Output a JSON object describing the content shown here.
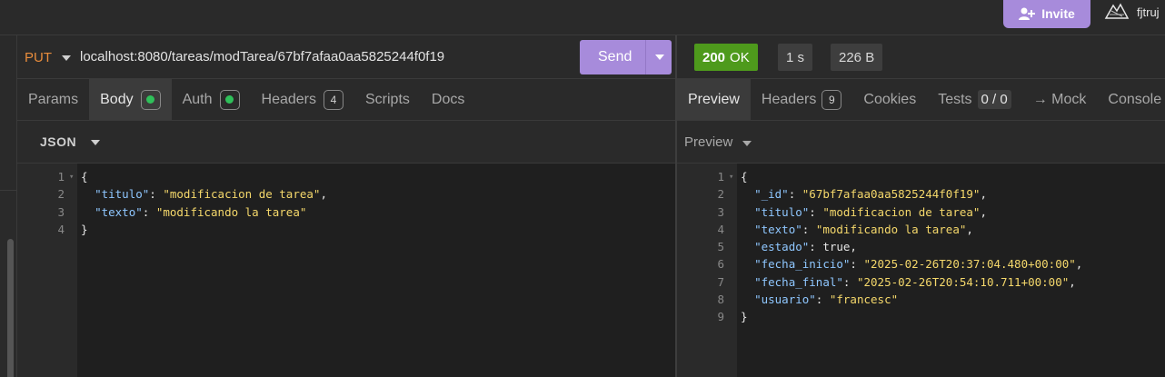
{
  "topbar": {
    "invite_label": "Invite",
    "username": "fjtruj"
  },
  "request": {
    "method": "PUT",
    "url": "localhost:8080/tareas/modTarea/67bf7afaa0aa5825244f0f19",
    "send_label": "Send",
    "tabs": [
      {
        "label": "Params"
      },
      {
        "label": "Body"
      },
      {
        "label": "Auth"
      },
      {
        "label": "Headers",
        "count": "4"
      },
      {
        "label": "Scripts"
      },
      {
        "label": "Docs"
      }
    ],
    "body_type": "JSON",
    "line_numbers": [
      "1",
      "2",
      "3",
      "4"
    ],
    "body_lines": [
      {
        "p": "{"
      },
      {
        "ind": "  ",
        "k": "\"titulo\"",
        "p": ": ",
        "v": "\"modificacion de tarea\"",
        "e": ","
      },
      {
        "ind": "  ",
        "k": "\"texto\"",
        "p": ": ",
        "v": "\"modificando la tarea\"",
        "e": ""
      },
      {
        "p": "}"
      }
    ]
  },
  "response": {
    "status_code": "200",
    "status_text": "OK",
    "time": "1 s",
    "size": "226 B",
    "tabs": [
      {
        "label": "Preview"
      },
      {
        "label": "Headers",
        "count": "9"
      },
      {
        "label": "Cookies"
      },
      {
        "label": "Tests",
        "value": "0 / 0"
      },
      {
        "label": "→ Mock"
      },
      {
        "label": "Console"
      }
    ],
    "preview_mode": "Preview",
    "line_numbers": [
      "1",
      "2",
      "3",
      "4",
      "5",
      "6",
      "7",
      "8",
      "9"
    ],
    "body_lines": [
      {
        "p": "{"
      },
      {
        "ind": "  ",
        "k": "\"_id\"",
        "p": ": ",
        "v": "\"67bf7afaa0aa5825244f0f19\"",
        "e": ","
      },
      {
        "ind": "  ",
        "k": "\"titulo\"",
        "p": ": ",
        "v": "\"modificacion de tarea\"",
        "e": ","
      },
      {
        "ind": "  ",
        "k": "\"texto\"",
        "p": ": ",
        "v": "\"modificando la tarea\"",
        "e": ","
      },
      {
        "ind": "  ",
        "k": "\"estado\"",
        "p": ": true,",
        "v": "",
        "e": ""
      },
      {
        "ind": "  ",
        "k": "\"fecha_inicio\"",
        "p": ": ",
        "v": "\"2025-02-26T20:37:04.480+00:00\"",
        "e": ","
      },
      {
        "ind": "  ",
        "k": "\"fecha_final\"",
        "p": ": ",
        "v": "\"2025-02-26T20:54:10.711+00:00\"",
        "e": ","
      },
      {
        "ind": "  ",
        "k": "\"usuario\"",
        "p": ": ",
        "v": "\"francesc\"",
        "e": ""
      },
      {
        "p": "}"
      }
    ]
  },
  "colors": {
    "accent": "#a78bdb",
    "method": "#e88c3c",
    "status_ok": "#4e9a1c",
    "json_key": "#8fc7ff",
    "json_string": "#f5d86b"
  }
}
